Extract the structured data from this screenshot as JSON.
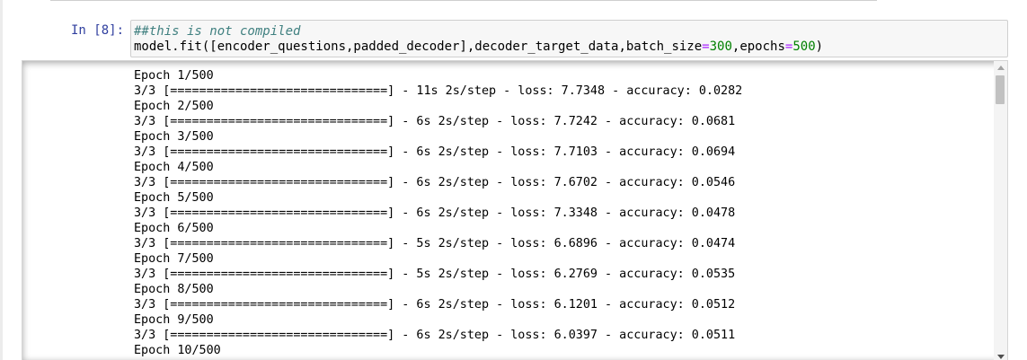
{
  "cell": {
    "prompt": "In [8]:",
    "code": {
      "comment": "##this is not compiled",
      "line2_prefix": "model.fit([encoder_questions,padded_decoder],decoder_target_data,batch_size",
      "eq1": "=",
      "batch_size": "300",
      "line2_mid": ",epochs",
      "eq2": "=",
      "epochs": "500",
      "line2_suffix": ")"
    }
  },
  "output": {
    "log_text": "Epoch 1/500\n3/3 [==============================] - 11s 2s/step - loss: 7.7348 - accuracy: 0.0282\nEpoch 2/500\n3/3 [==============================] - 6s 2s/step - loss: 7.7242 - accuracy: 0.0681\nEpoch 3/500\n3/3 [==============================] - 6s 2s/step - loss: 7.7103 - accuracy: 0.0694\nEpoch 4/500\n3/3 [==============================] - 6s 2s/step - loss: 7.6702 - accuracy: 0.0546\nEpoch 5/500\n3/3 [==============================] - 6s 2s/step - loss: 7.3348 - accuracy: 0.0478\nEpoch 6/500\n3/3 [==============================] - 5s 2s/step - loss: 6.6896 - accuracy: 0.0474\nEpoch 7/500\n3/3 [==============================] - 5s 2s/step - loss: 6.2769 - accuracy: 0.0535\nEpoch 8/500\n3/3 [==============================] - 6s 2s/step - loss: 6.1201 - accuracy: 0.0512\nEpoch 9/500\n3/3 [==============================] - 6s 2s/step - loss: 6.0397 - accuracy: 0.0511\nEpoch 10/500"
  },
  "colors": {
    "prompt": "#303f9f",
    "comment": "#408080",
    "number": "#008000",
    "operator": "#aa22ff",
    "input_background": "#f7f7f7"
  },
  "icons": {
    "scroll_up": "arrow-up",
    "scroll_down": "arrow-down"
  }
}
